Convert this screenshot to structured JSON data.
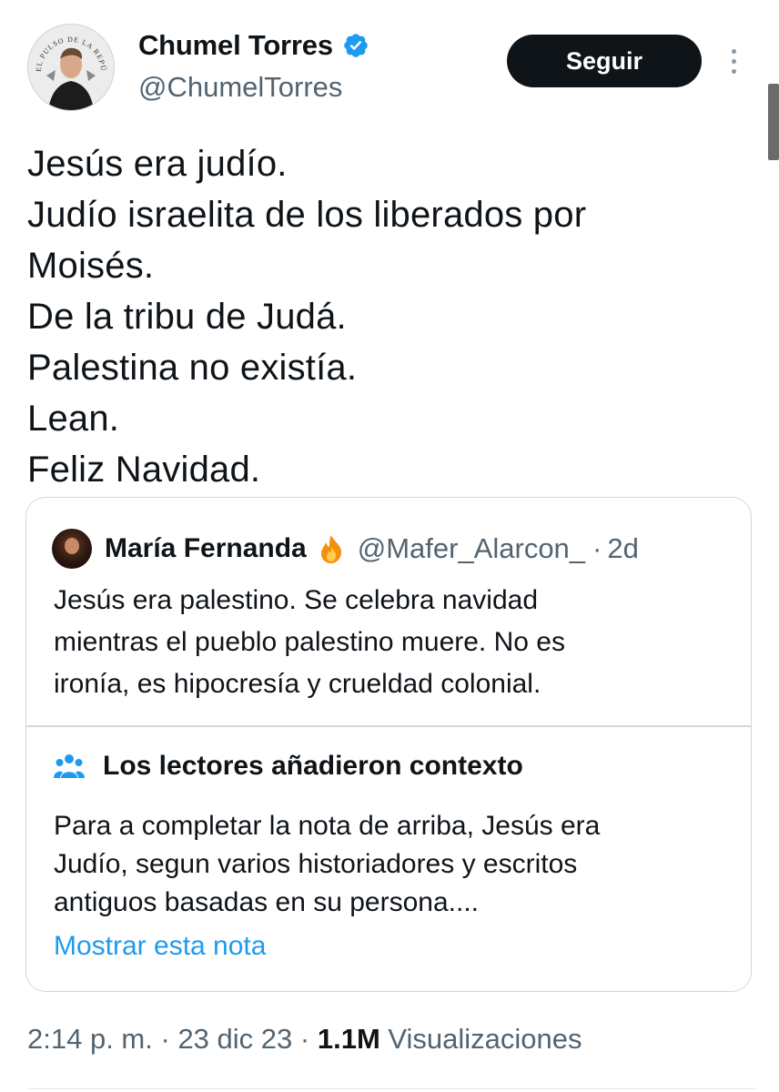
{
  "author": {
    "display_name": "Chumel Torres",
    "handle": "@ChumelTorres",
    "avatar_text": "EL PULSO DE LA REPÚBLICA",
    "verified": true,
    "follow_label": "Seguir"
  },
  "tweet": {
    "lines": [
      "Jesús era judío.",
      "Judío israelita de los liberados por",
      "Moisés.",
      "De la tribu de Judá.",
      "Palestina no existía.",
      "Lean.",
      "Feliz Navidad."
    ]
  },
  "quote": {
    "name": "María Fernanda",
    "emoji": "fire-emoji",
    "handle": "@Mafer_Alarcon_",
    "separator": "·",
    "age": "2d",
    "lines": [
      "Jesús era palestino. Se celebra navidad",
      "mientras el pueblo palestino muere. No es",
      "ironía, es hipocresía y crueldad colonial."
    ]
  },
  "community_note": {
    "title": "Los lectores añadieron contexto",
    "lines": [
      "Para a completar la nota de arriba, Jesús era",
      "Judío, segun varios historiadores y escritos",
      "antiguos basadas en su persona...."
    ],
    "link": "Mostrar esta nota"
  },
  "meta": {
    "time": "2:14 p. m.",
    "sep1": "·",
    "date": "23 dic 23",
    "sep2": "·",
    "views": "1.1M",
    "views_label": "Visualizaciones"
  },
  "colors": {
    "accent": "#1d9bf0",
    "text": "#0f1419",
    "secondary": "#536471",
    "border": "#cfd9de",
    "button": "#0f1419"
  }
}
